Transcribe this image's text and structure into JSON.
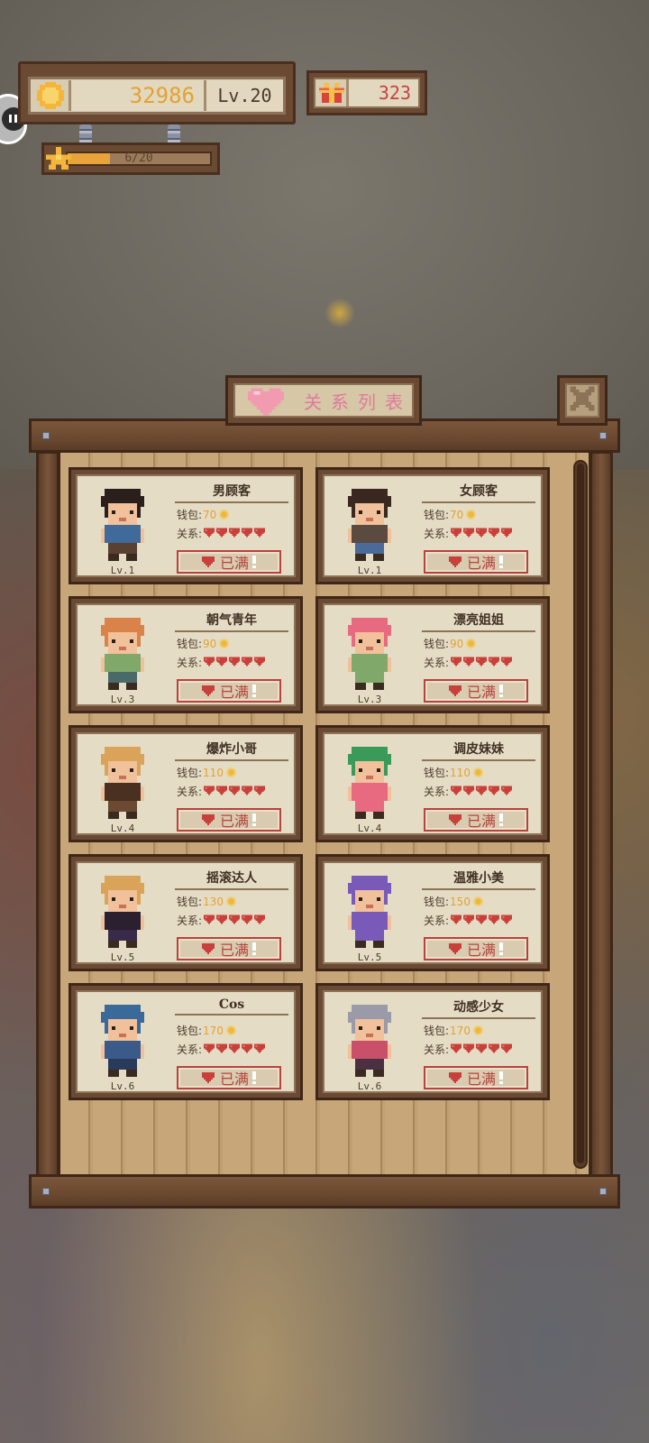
{
  "hud": {
    "coins": "32986",
    "level": "Lv.20",
    "gifts": "323",
    "xp_text": "6/20",
    "xp_progress": 0.3
  },
  "dialog": {
    "title": "关系列表"
  },
  "characters": [
    {
      "name": "男顾客",
      "level": "Lv.1",
      "wallet_label": "钱包:",
      "wallet": "70",
      "relation_label": "关系:",
      "hearts": 5,
      "button": "已满",
      "avatar": {
        "hair": "#2b1f1c",
        "skin": "#f0c19a",
        "shirt": "#3f6a9a",
        "pants": "#5a4030"
      }
    },
    {
      "name": "女顾客",
      "level": "Lv.1",
      "wallet_label": "钱包:",
      "wallet": "70",
      "relation_label": "关系:",
      "hearts": 5,
      "button": "已满",
      "avatar": {
        "hair": "#3a2820",
        "skin": "#f0c19a",
        "shirt": "#5a4a40",
        "pants": "#4a6a9a"
      }
    },
    {
      "name": "朝气青年",
      "level": "Lv.3",
      "wallet_label": "钱包:",
      "wallet": "90",
      "relation_label": "关系:",
      "hearts": 5,
      "button": "已满",
      "avatar": {
        "hair": "#d9824a",
        "skin": "#f0c19a",
        "shirt": "#7fa86a",
        "pants": "#4a6a6a"
      }
    },
    {
      "name": "漂亮姐姐",
      "level": "Lv.3",
      "wallet_label": "钱包:",
      "wallet": "90",
      "relation_label": "关系:",
      "hearts": 5,
      "button": "已满",
      "avatar": {
        "hair": "#e86a80",
        "skin": "#f0c19a",
        "shirt": "#7fa86a",
        "pants": "#7fa86a"
      }
    },
    {
      "name": "爆炸小哥",
      "level": "Lv.4",
      "wallet_label": "钱包:",
      "wallet": "110",
      "relation_label": "关系:",
      "hearts": 5,
      "button": "已满",
      "avatar": {
        "hair": "#d9a45a",
        "skin": "#f0c19a",
        "shirt": "#4a3020",
        "pants": "#6a4a30"
      }
    },
    {
      "name": "调皮妹妹",
      "level": "Lv.4",
      "wallet_label": "钱包:",
      "wallet": "110",
      "relation_label": "关系:",
      "hearts": 5,
      "button": "已满",
      "avatar": {
        "hair": "#3a9a5a",
        "skin": "#f0c19a",
        "shirt": "#e86a80",
        "pants": "#e86a80"
      }
    },
    {
      "name": "摇滚达人",
      "level": "Lv.5",
      "wallet_label": "钱包:",
      "wallet": "130",
      "relation_label": "关系:",
      "hearts": 5,
      "button": "已满",
      "avatar": {
        "hair": "#d9a45a",
        "skin": "#f0c19a",
        "shirt": "#2a2030",
        "pants": "#3a2a4a"
      }
    },
    {
      "name": "温雅小美",
      "level": "Lv.5",
      "wallet_label": "钱包:",
      "wallet": "150",
      "relation_label": "关系:",
      "hearts": 5,
      "button": "已满",
      "avatar": {
        "hair": "#7a5ab8",
        "skin": "#f0c19a",
        "shirt": "#7a5ab8",
        "pants": "#7a5ab8"
      }
    },
    {
      "name": "Cos",
      "level": "Lv.6",
      "wallet_label": "钱包:",
      "wallet": "170",
      "relation_label": "关系:",
      "hearts": 5,
      "button": "已满",
      "avatar": {
        "hair": "#3a6a9a",
        "skin": "#f0c19a",
        "shirt": "#3a5a8a",
        "pants": "#2a3a5a"
      }
    },
    {
      "name": "动感少女",
      "level": "Lv.6",
      "wallet_label": "钱包:",
      "wallet": "170",
      "relation_label": "关系:",
      "hearts": 5,
      "button": "已满",
      "avatar": {
        "hair": "#9a9aa8",
        "skin": "#f0c19a",
        "shirt": "#c8506a",
        "pants": "#4a3040"
      }
    }
  ],
  "icons": {
    "coin": "coin-icon",
    "gift": "gift-icon",
    "star": "star-icon",
    "heart": "heart-icon",
    "close": "close-icon",
    "chat": "chat-icon"
  },
  "colors": {
    "coin_text": "#e3a233",
    "gift_text": "#c64242",
    "heart": "#c8403a",
    "title_text": "#e07a9c"
  }
}
